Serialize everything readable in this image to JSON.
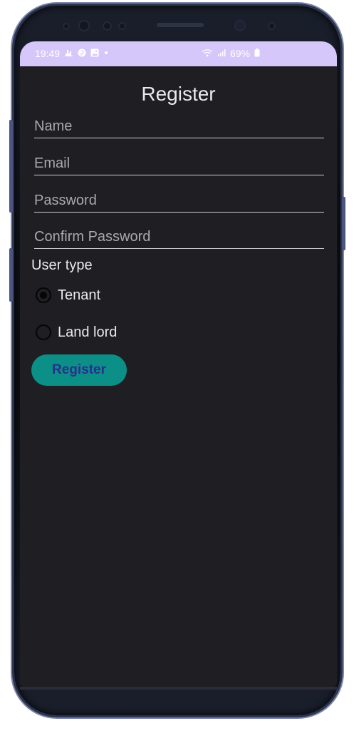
{
  "status_bar": {
    "time": "19:49",
    "left_icons": [
      "weather-icon",
      "pinterest-icon",
      "gallery-icon",
      "dot-icon"
    ],
    "right_icons": [
      "wifi-icon",
      "signal-icon",
      "battery-icon"
    ],
    "battery": "69%",
    "color": "#d6c7fa"
  },
  "form": {
    "title": "Register",
    "name_placeholder": "Name",
    "email_placeholder": "Email",
    "password_placeholder": "Password",
    "confirm_password_placeholder": "Confirm Password",
    "user_type_label": "User type",
    "options": [
      {
        "label": "Tenant",
        "checked": true
      },
      {
        "label": "Land lord",
        "checked": false
      }
    ],
    "register_label": "Register"
  },
  "colors": {
    "background": "#1e1e23",
    "button": "#0b8f87",
    "button_text": "#2a2f8f"
  }
}
